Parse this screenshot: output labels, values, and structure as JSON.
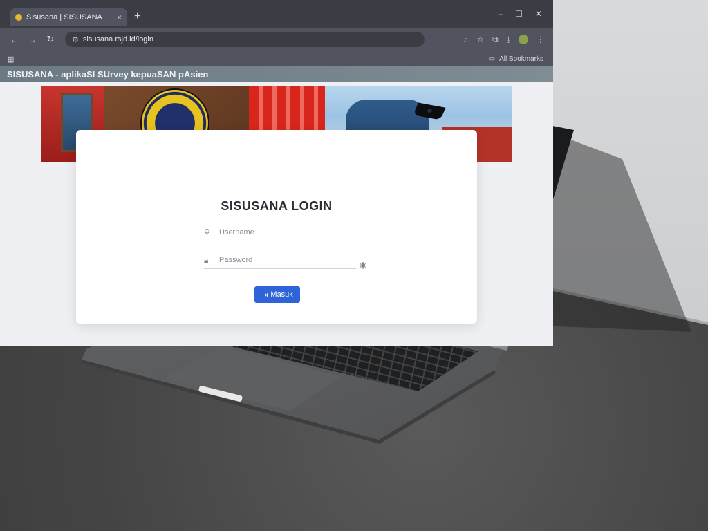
{
  "browser": {
    "tab_title": "Sisusana | SISUSANA",
    "tab_close": "×",
    "new_tab": "+",
    "window_controls": [
      "–",
      "☐",
      "✕"
    ],
    "url": "sisusana.rsjd.id/login",
    "bookmarks_label": "All Bookmarks"
  },
  "page": {
    "header_title": "SISUSANA - aplikaSI SUrvey kepuaSAN pAsien",
    "login_title": "SISUSANA LOGIN",
    "username_placeholder": "Username",
    "password_placeholder": "Password",
    "login_button": "Masuk"
  },
  "icons": {
    "favicon": "favicon-icon",
    "back": "back-arrow-icon",
    "forward": "forward-arrow-icon",
    "reload": "reload-icon",
    "user": "user-icon",
    "lock": "lock-icon",
    "eye": "eye-icon",
    "login": "login-icon"
  },
  "colors": {
    "login_button": "#2f64d8",
    "title_bar": "#6c7a84",
    "browser_chrome": "#3b3d45"
  }
}
